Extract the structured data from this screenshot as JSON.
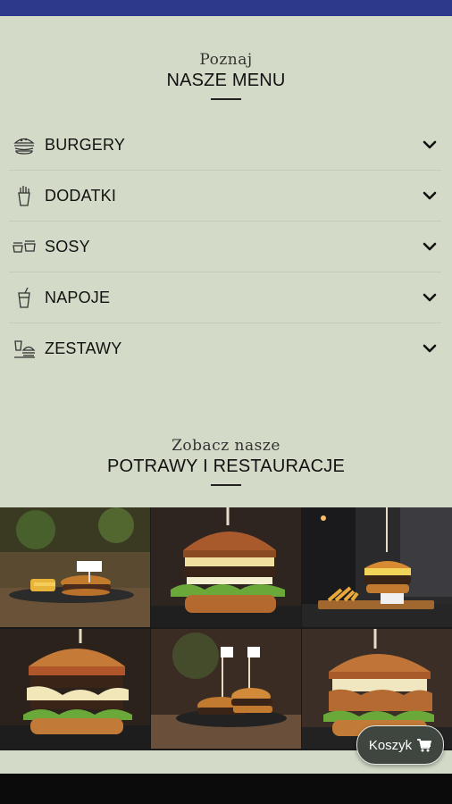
{
  "menu_section": {
    "kicker": "Poznaj",
    "title": "NASZE MENU",
    "items": [
      {
        "label": "BURGERY",
        "icon": "burger-icon"
      },
      {
        "label": "DODATKI",
        "icon": "fries-icon"
      },
      {
        "label": "SOSY",
        "icon": "sauce-icon"
      },
      {
        "label": "NAPOJE",
        "icon": "drink-icon"
      },
      {
        "label": "ZESTAWY",
        "icon": "combo-set-icon"
      }
    ]
  },
  "gallery_section": {
    "kicker": "Zobacz nasze",
    "title": "POTRAWY I RESTAURACJE",
    "photos": [
      "burger-with-fries-photo",
      "tall-burger-photo",
      "restaurant-chef-photo",
      "bacon-burger-photo",
      "two-mini-burgers-photo",
      "chicken-burger-photo"
    ]
  },
  "cart": {
    "label": "Koszyk",
    "icon": "cart-icon"
  },
  "colors": {
    "background": "#d3dbc8",
    "status_bar": "#2d3a8c",
    "cart_button": "#3f4640"
  }
}
